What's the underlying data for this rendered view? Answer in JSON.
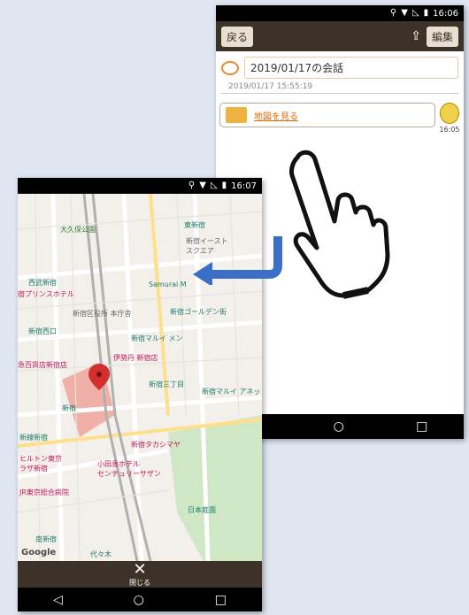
{
  "chat_phone": {
    "status_time": "16:06",
    "back_label": "戻る",
    "edit_label": "編集",
    "conversation_title": "2019/01/17の会話",
    "conversation_datetime": "2019/01/17 15:55:19",
    "message_link": "地図を見る",
    "message_time": "16:05"
  },
  "map_phone": {
    "status_time": "16:07",
    "close_label": "閉じる",
    "map_labels": {
      "okubo_park": "大久保公園",
      "higashi_shinjuku": "東新宿",
      "east_square": "新宿イースト\nスクエア",
      "seibu_shinjuku": "西武新宿",
      "samurai": "Samurai M",
      "prince_hotel": "宿プリンスホテル",
      "ward_office": "新宿区役所 本庁舎",
      "golden_gai": "新宿ゴールデン街",
      "shinjuku_nishiguchi": "新宿西口",
      "marui_men": "新宿マルイ メン",
      "odakyu": "急百貨店新宿店",
      "isetan": "伊勢丹 新宿店",
      "sanchome": "新宿三丁目",
      "marui_annex": "新宿マルイ アネッ",
      "shinjuku": "新宿",
      "minami_shinjuku_line": "新線新宿",
      "takashimaya": "新宿タカシマヤ",
      "hilton": "ヒルトン東京\nラザ新宿",
      "southern": "小田急ホテル\nセンチュリーサザン",
      "jr_building": "JR東京総合病院",
      "nihon_kogakuin": "日本庭園",
      "minami_shinjuku": "南新宿",
      "yoyogi": "代々木",
      "google": "Google"
    }
  },
  "colors": {
    "toolbar": "#3d3228",
    "accent_orange": "#e36a00",
    "arrow_blue": "#3b6fc6",
    "page_bg": "#dfe6f2"
  }
}
